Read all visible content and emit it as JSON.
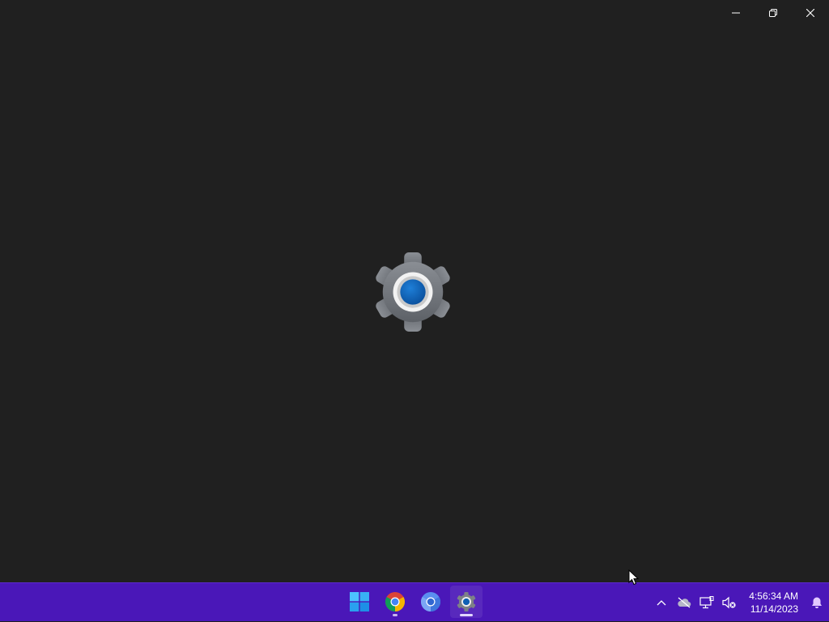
{
  "window": {
    "controls": {
      "minimize": "minimize-icon",
      "restore": "restore-icon",
      "close": "close-icon"
    },
    "splash_icon": "settings-gear-icon"
  },
  "taskbar": {
    "background": "#4a17b8",
    "apps": [
      {
        "icon": "windows-start-icon",
        "running": false
      },
      {
        "icon": "chrome-icon",
        "running": true
      },
      {
        "icon": "chromium-icon",
        "running": false
      },
      {
        "icon": "settings-icon",
        "running": true,
        "active": true
      }
    ],
    "tray": {
      "icons": [
        "chevron-up-icon",
        "onedrive-offline-icon",
        "network-icon",
        "volume-muted-icon",
        "notification-bell-icon"
      ],
      "time": "4:56:34 AM",
      "date": "11/14/2023"
    }
  },
  "colors": {
    "app_background": "#202020",
    "accent_blue": "#0f6cbd"
  }
}
